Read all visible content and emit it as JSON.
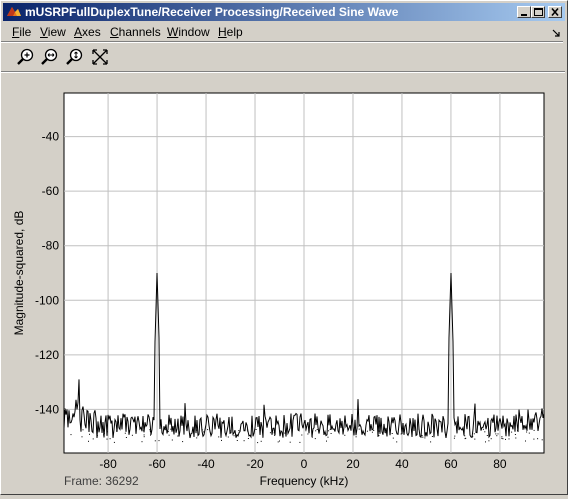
{
  "window": {
    "title": "mUSRPFullDuplexTune/Receiver Processing/Received Sine Wave",
    "controls": [
      "minimize",
      "maximize",
      "close"
    ]
  },
  "menubar": {
    "items": [
      "File",
      "View",
      "Axes",
      "Channels",
      "Window",
      "Help"
    ],
    "dock_icon": "dock-arrow-icon"
  },
  "toolbar": {
    "tools": [
      {
        "name": "zoom-in-icon"
      },
      {
        "name": "zoom-x-icon"
      },
      {
        "name": "zoom-y-icon"
      },
      {
        "name": "autoscale-icon"
      }
    ]
  },
  "status": {
    "frame_label": "Frame: 36292"
  },
  "colors": {
    "titlebar_start": "#0a246a",
    "titlebar_end": "#a6caf0",
    "plot_bg": "#ffffff",
    "grid": "#c0c0c0",
    "trace": "#000000"
  },
  "chart_data": {
    "type": "line",
    "title": "",
    "xlabel": "Frequency (kHz)",
    "ylabel": "Magnitude-squared, dB",
    "xlim": [
      -98,
      98
    ],
    "ylim": [
      -156,
      -24
    ],
    "xticks": [
      -80,
      -60,
      -40,
      -20,
      0,
      20,
      40,
      60,
      80
    ],
    "yticks": [
      -140,
      -120,
      -100,
      -80,
      -60,
      -40
    ],
    "grid": true,
    "series": [
      {
        "noise_floor_db": -146,
        "peaks": [
          {
            "x": -60,
            "y": -90
          },
          {
            "x": 60,
            "y": -90
          },
          {
            "x": -92,
            "y": -129
          }
        ]
      }
    ]
  }
}
